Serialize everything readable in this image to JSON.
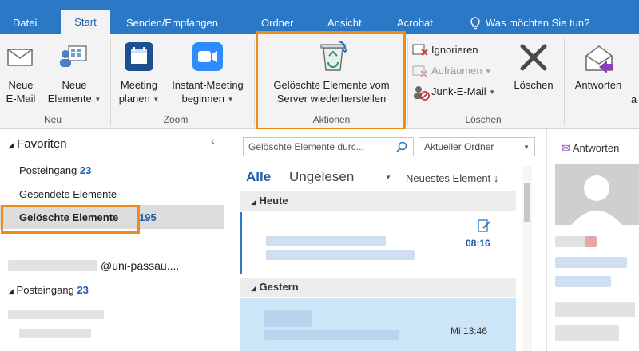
{
  "tabs": [
    "Datei",
    "Start",
    "Senden/Empfangen",
    "Ordner",
    "Ansicht",
    "Acrobat"
  ],
  "tell_me": "Was möchten Sie tun?",
  "ribbon": {
    "new_email": [
      "Neue",
      "E-Mail"
    ],
    "new_items": [
      "Neue",
      "Elemente"
    ],
    "group_new": "Neu",
    "meeting_plan": [
      "Meeting",
      "planen"
    ],
    "instant_meeting": [
      "Instant-Meeting",
      "beginnen"
    ],
    "group_zoom": "Zoom",
    "restore": [
      "Gelöschte Elemente vom",
      "Server wiederherstellen"
    ],
    "group_actions": "Aktionen",
    "ignore": "Ignorieren",
    "cleanup": "Aufräumen",
    "junk": "Junk-E-Mail",
    "delete": "Löschen",
    "group_delete": "Löschen",
    "reply": "Antworten",
    "reply_all_fragment": "a"
  },
  "folders": {
    "favorites": "Favoriten",
    "inbox": "Posteingang",
    "inbox_count": "23",
    "sent": "Gesendete Elemente",
    "deleted": "Gelöschte Elemente",
    "deleted_count": "195",
    "account_suffix": "@uni-passau....",
    "inbox2": "Posteingang",
    "inbox2_count": "23"
  },
  "list": {
    "search_placeholder": "Gelöschte Elemente durc...",
    "scope": "Aktueller Ordner",
    "filter_all": "Alle",
    "filter_unread": "Ungelesen",
    "sort": "Neuestes Element",
    "group_today": "Heute",
    "time_today": "08:16",
    "group_yesterday": "Gestern",
    "time_yesterday": "Mi 13:46"
  },
  "reading": {
    "reply": "Antworten"
  },
  "colors": {
    "accent": "#2b78c7",
    "highlight": "#f08a1a",
    "count": "#1f5da8"
  }
}
